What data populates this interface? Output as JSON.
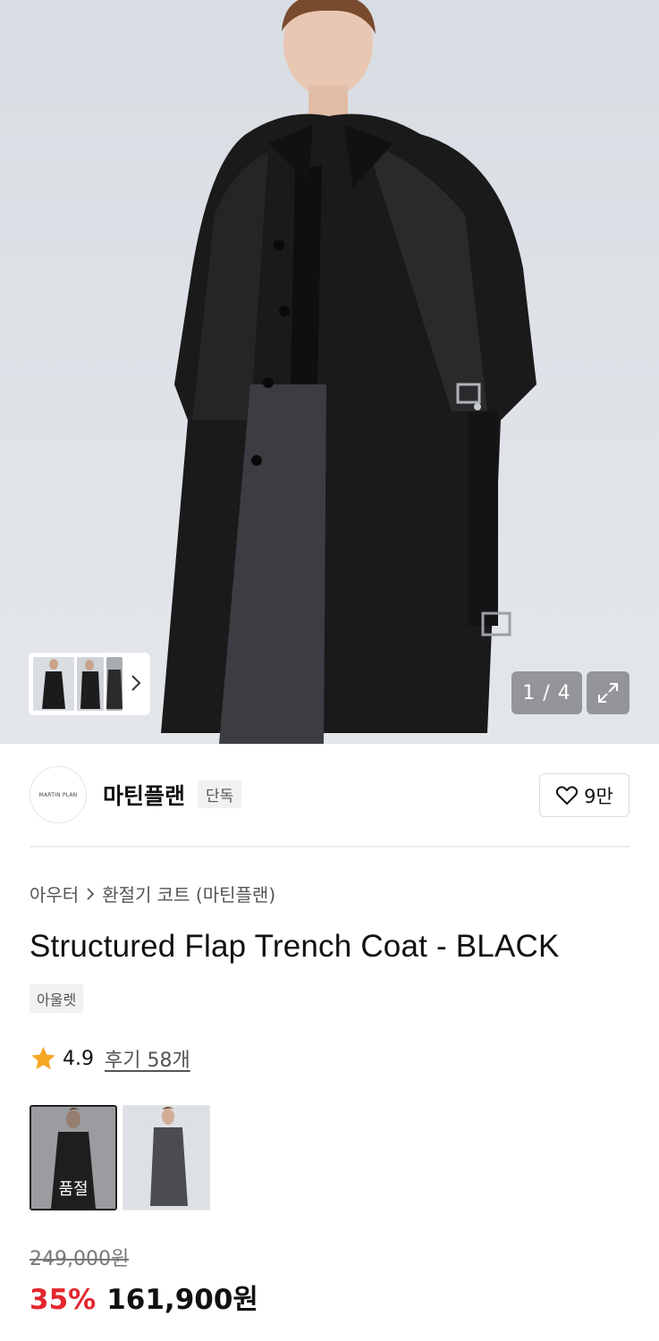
{
  "gallery": {
    "counter": "1 / 4",
    "thumbnails": [
      "thumb-front",
      "thumb-side",
      "thumb-back"
    ]
  },
  "brand": {
    "logo_text": "MARTIN PLAN",
    "name": "마틴플랜",
    "badge": "단독",
    "likes": "9만"
  },
  "product": {
    "breadcrumb": [
      "아우터",
      "환절기 코트 (마틴플랜)"
    ],
    "title": "Structured Flap Trench Coat - BLACK",
    "tag": "아울렛",
    "rating": "4.9",
    "reviews": "후기 58개",
    "color_options": [
      {
        "status": "품절",
        "selected": true
      },
      {
        "status": "",
        "selected": false
      }
    ],
    "original_price": "249,000원",
    "discount": "35%",
    "final_price": "161,900원"
  },
  "colors": {
    "accent_red": "#e3262f",
    "star": "#f5a623"
  }
}
